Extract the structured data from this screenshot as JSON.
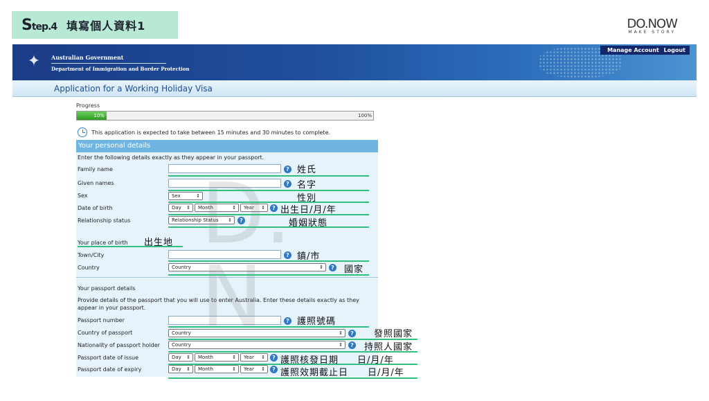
{
  "banner": {
    "step_prefix": "S",
    "step_suffix": "tep.4",
    "title": "填寫個人資料1"
  },
  "logo": {
    "main": "DO.NOW",
    "sub": "MAKE STORY"
  },
  "gov_header": {
    "line1": "Australian Government",
    "line2": "Department of Immigration and Border Protection",
    "manage_account": "Manage Account",
    "logout": "Logout"
  },
  "app_title": "Application for a Working Holiday Visa",
  "progress": {
    "label": "Progress",
    "percent_label": "10%",
    "end_label": "100%",
    "value": 10
  },
  "time_note": "This application is expected to take between 15 minutes and 30 minutes to complete.",
  "personal": {
    "heading": "Your personal details",
    "intro": "Enter the following details exactly as they appear in your passport.",
    "family_name": "Family name",
    "given_names": "Given names",
    "sex": "Sex",
    "sex_select": "Sex",
    "dob": "Date of birth",
    "day": "Day",
    "month": "Month",
    "year": "Year",
    "relationship": "Relationship status",
    "relationship_select": "Relationship Status"
  },
  "birth": {
    "heading": "Your place of birth",
    "town": "Town/City",
    "country": "Country",
    "country_select": "Country"
  },
  "passport": {
    "heading": "Your passport details",
    "intro": "Provide details of the passport that you will use to enter Australia. Enter these details exactly as they appear in your passport.",
    "number": "Passport number",
    "country_of_passport": "Country of passport",
    "nationality": "Nationality of passport holder",
    "date_issue": "Passport date of issue",
    "date_expiry": "Passport date of expiry",
    "country_select": "Country",
    "day": "Day",
    "month": "Month",
    "year": "Year"
  },
  "annotations": {
    "family_name": "姓氏",
    "given_names": "名字",
    "sex": "性別",
    "dob": "出生日/月/年",
    "relationship": "婚姻狀態",
    "birth_place": "出生地",
    "town": "鎮/市",
    "country": "國家",
    "passport_number": "護照號碼",
    "issuing_country": "發照國家",
    "nationality": "持照人國家",
    "date_issue": "護照核發日期",
    "date_issue_format": "日/月/年",
    "date_expiry": "護照效期截止日",
    "date_expiry_format": "日/月/年"
  },
  "colors": {
    "banner": "#b7e9d4",
    "header": "#1f4f9e",
    "panel": "#e6f3fb",
    "panel_head": "#6eb5e2",
    "underline": "#2fbf7e",
    "help": "#2f78c5"
  }
}
